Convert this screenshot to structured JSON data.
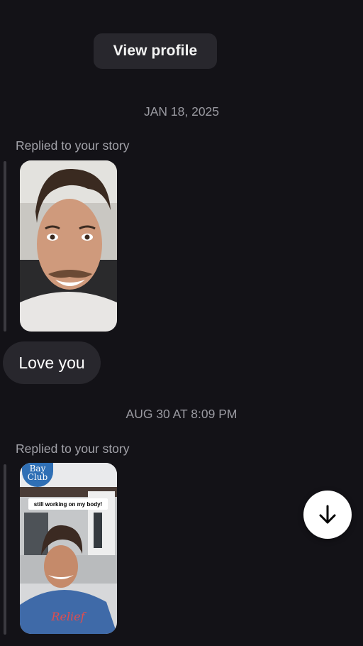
{
  "header": {
    "view_profile_label": "View profile"
  },
  "thread": {
    "date_1": "JAN 18, 2025",
    "replied_1": "Replied to your story",
    "message_1": "Love you",
    "date_2": "AUG 30 AT 8:09 PM",
    "replied_2": "Replied to your story",
    "story_2_caption": "still working on my body!",
    "story_2_logo": "Bay Club"
  },
  "controls": {
    "scroll_down_icon": "arrow-down-icon"
  },
  "colors": {
    "background": "#131217",
    "bubble": "#28272d",
    "muted_text": "#9a9aa1"
  }
}
